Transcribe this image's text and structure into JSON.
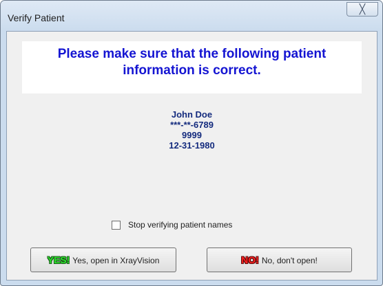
{
  "window": {
    "title": "Verify Patient",
    "close_icon": "close-icon",
    "close_glyph": "╳"
  },
  "banner": {
    "text": "Please make sure that the following patient information is correct."
  },
  "patient": {
    "name": "John Doe",
    "ssn": "***-**-6789",
    "id": "9999",
    "dob": "12-31-1980"
  },
  "checkbox": {
    "label": "Stop verifying patient names",
    "checked": false
  },
  "buttons": {
    "yes": {
      "word": "YES!",
      "label": "Yes, open in XrayVision"
    },
    "no": {
      "word": "NO!",
      "label": "No, don't open!"
    }
  },
  "colors": {
    "banner_text": "#1414d2",
    "patient_text": "#142b7e",
    "yes_word": "#2ae02a",
    "no_word": "#ff2020"
  }
}
